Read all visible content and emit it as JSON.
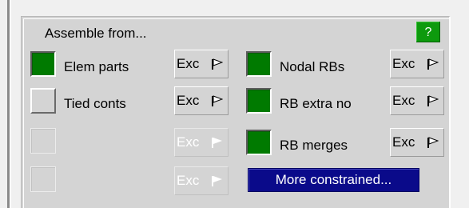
{
  "panel": {
    "title": "Assemble from...",
    "help_label": "?"
  },
  "left_rows": [
    {
      "label": "Elem parts",
      "state": "on",
      "exc_label": "Exc",
      "exc_enabled": true
    },
    {
      "label": "Tied conts",
      "state": "off",
      "exc_label": "Exc",
      "exc_enabled": true
    },
    {
      "label": "",
      "state": "disabled",
      "exc_label": "Exc",
      "exc_enabled": false
    },
    {
      "label": "",
      "state": "disabled",
      "exc_label": "Exc",
      "exc_enabled": false
    }
  ],
  "right_rows": [
    {
      "label": "Nodal RBs",
      "state": "on",
      "exc_label": "Exc",
      "exc_enabled": true
    },
    {
      "label": "RB extra no",
      "state": "on",
      "exc_label": "Exc",
      "exc_enabled": true
    },
    {
      "label": "RB merges",
      "state": "on",
      "exc_label": "Exc",
      "exc_enabled": true
    }
  ],
  "more_button": {
    "label": "More constrained..."
  },
  "colors": {
    "toggle_on": "#007a00",
    "help_green": "#0d9a0d",
    "more_blue": "#0a0a8a",
    "panel_bg": "#d4d4d4"
  },
  "icons": {
    "exc_flag": "flag-icon"
  }
}
